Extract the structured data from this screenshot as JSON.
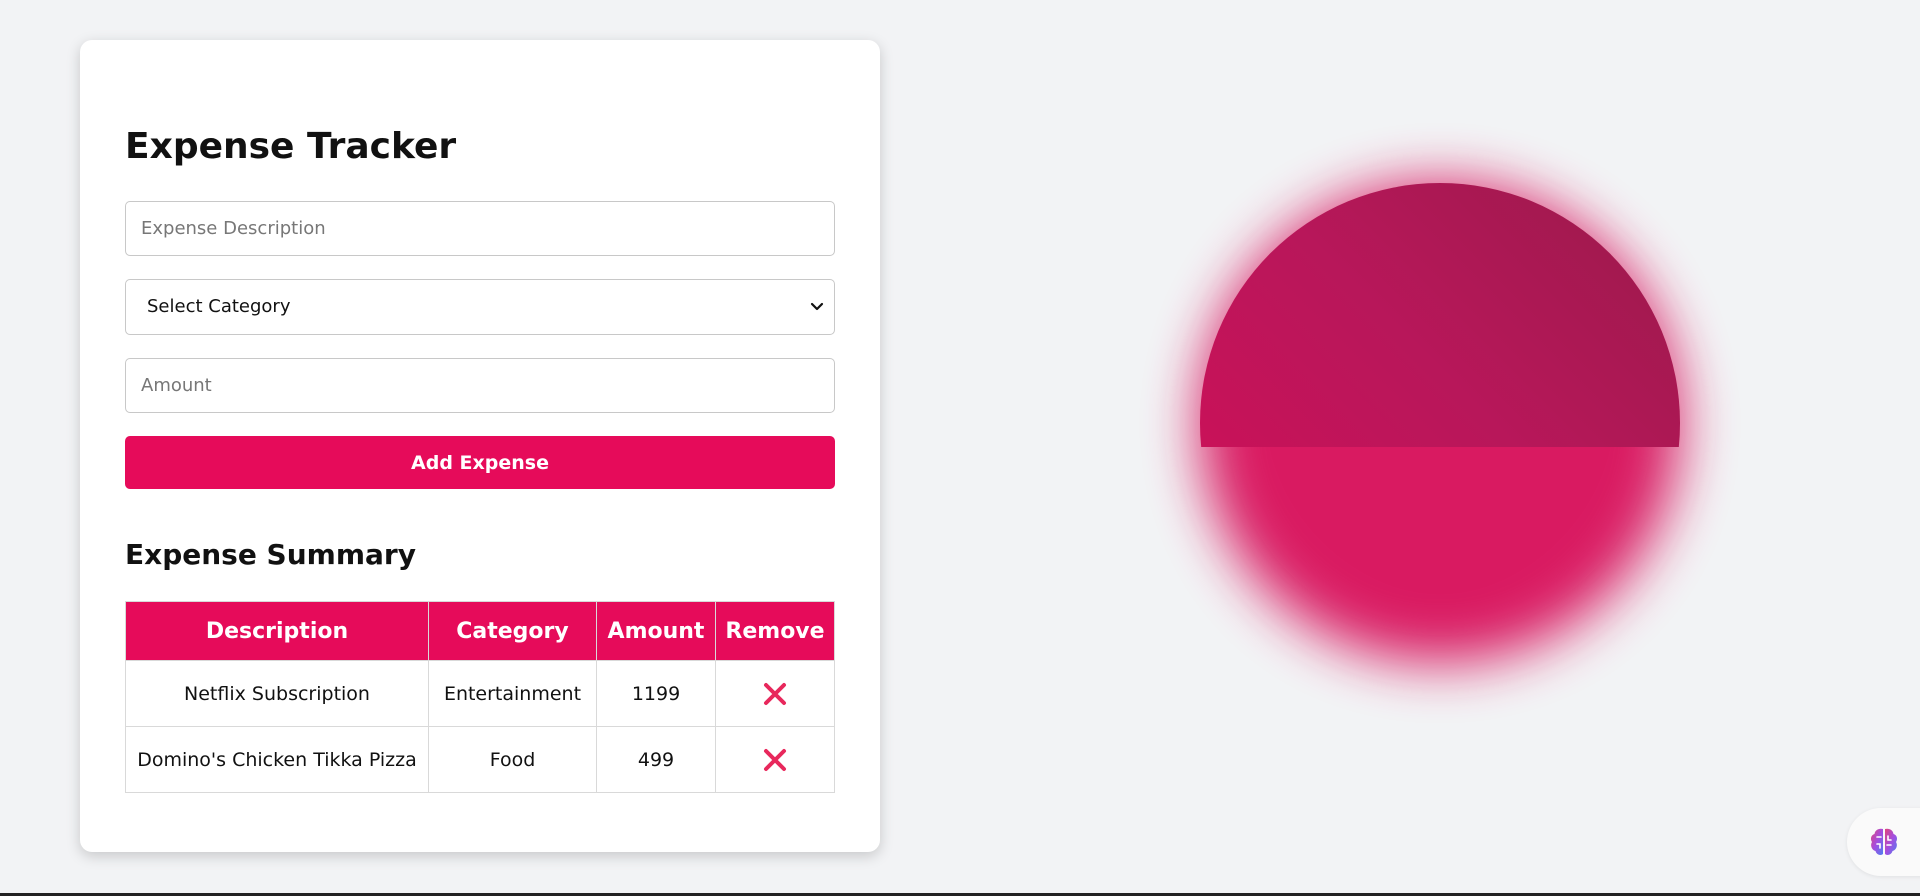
{
  "form": {
    "title": "Expense Tracker",
    "description_placeholder": "Expense Description",
    "category_selected": "Select Category",
    "amount_placeholder": "Amount",
    "add_button_label": "Add Expense"
  },
  "summary": {
    "title": "Expense Summary",
    "columns": [
      "Description",
      "Category",
      "Amount",
      "Remove"
    ],
    "rows": [
      {
        "description": "Netflix Subscription",
        "category": "Entertainment",
        "amount": "1199",
        "remove_icon": "close-icon"
      },
      {
        "description": "Domino's Chicken Tikka Pizza",
        "category": "Food",
        "amount": "499",
        "remove_icon": "close-icon"
      }
    ]
  },
  "decoration": {
    "blob_colors": [
      "#9c1a4b",
      "#c01656",
      "#db0c5a"
    ]
  },
  "helper_widget": {
    "icon": "brain-icon"
  },
  "colors": {
    "accent": "#e60b5a",
    "background": "#f2f3f5",
    "card": "#ffffff",
    "remove_icon": "#e8285c"
  }
}
